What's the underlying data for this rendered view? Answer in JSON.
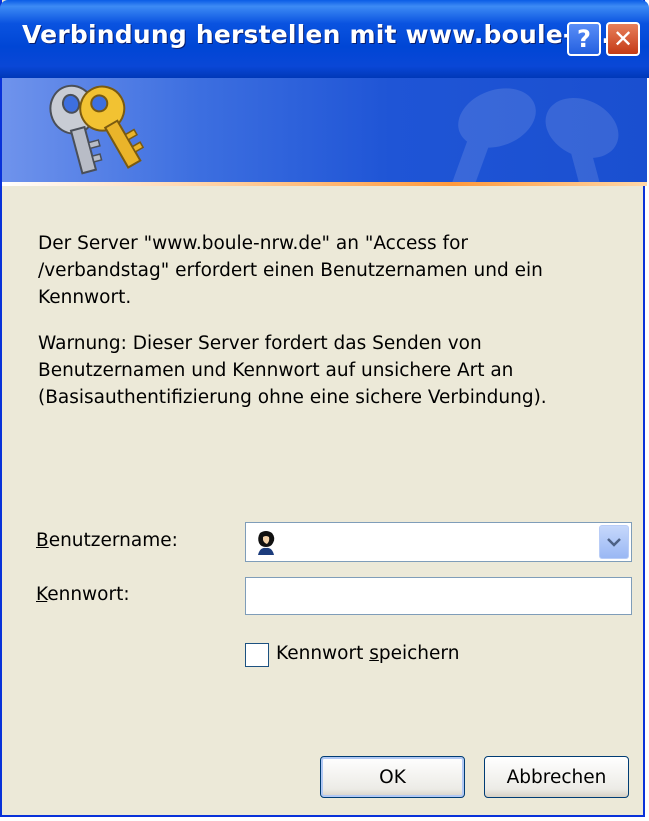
{
  "window": {
    "title": "Verbindung herstellen mit www.boule-n...",
    "help_glyph": "?",
    "close_glyph": "✕"
  },
  "banner": {
    "icon": "keys-icon"
  },
  "message": {
    "paragraph1": "Der Server \"www.boule-nrw.de\" an \"Access for /verbandstag\" erfordert einen Benutzernamen und ein Kennwort.",
    "paragraph2": "Warnung: Dieser Server fordert das Senden von Benutzernamen und Kennwort auf unsichere Art an (Basisauthentifizierung ohne eine sichere Verbindung)."
  },
  "form": {
    "username_label_mnemonic": "B",
    "username_label_rest": "enutzername:",
    "username_value": "",
    "password_label_mnemonic": "K",
    "password_label_rest": "ennwort:",
    "password_value": "",
    "remember_label_pre": "Kennwort ",
    "remember_label_mnemonic": "s",
    "remember_label_post": "peichern",
    "remember_checked": false
  },
  "buttons": {
    "ok": "OK",
    "cancel": "Abbrechen"
  },
  "colors": {
    "titlebar": "#0054e3",
    "dialog_bg": "#ece9d8",
    "close_button": "#d9542c",
    "accent_line": "#ff9a3c"
  }
}
